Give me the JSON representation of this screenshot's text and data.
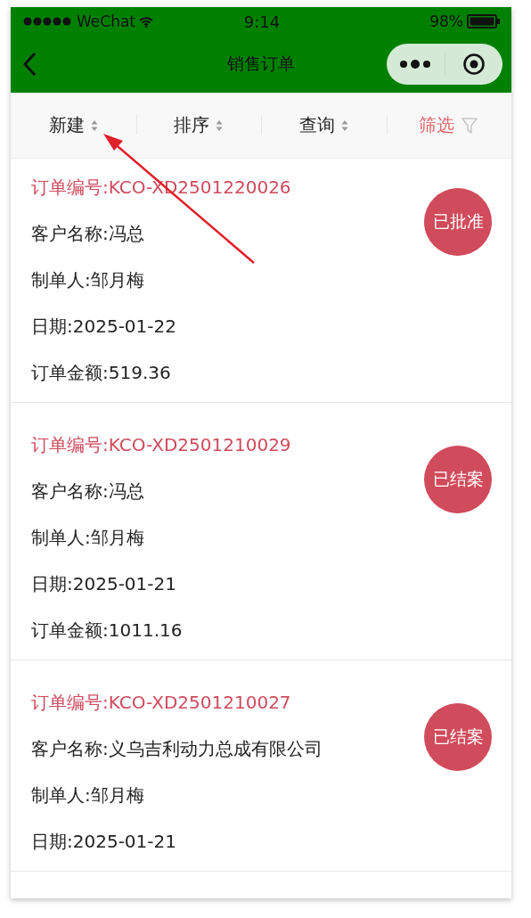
{
  "status_bar": {
    "carrier": "WeChat",
    "time": "9:14",
    "battery": "98%"
  },
  "nav_bar": {
    "title": "销售订单"
  },
  "toolbar": [
    {
      "label": "新建",
      "kind": "sort"
    },
    {
      "label": "排序",
      "kind": "sort"
    },
    {
      "label": "查询",
      "kind": "sort"
    },
    {
      "label": "筛选",
      "kind": "filter"
    }
  ],
  "orders": [
    {
      "title": "订单编号:KCO-XD2501220026",
      "status": "已批准",
      "fields": [
        "客户名称:冯总",
        "制单人:邹月梅",
        "日期:2025-01-22",
        "订单金额:519.36"
      ]
    },
    {
      "title": "订单编号:KCO-XD2501210029",
      "status": "已结案",
      "fields": [
        "客户名称:冯总",
        "制单人:邹月梅",
        "日期:2025-01-21",
        "订单金额:1011.16"
      ]
    },
    {
      "title": "订单编号:KCO-XD2501210027",
      "status": "已结案",
      "fields": [
        "客户名称:义乌吉利动力总成有限公司",
        "制单人:邹月梅",
        "日期:2025-01-21"
      ]
    }
  ]
}
